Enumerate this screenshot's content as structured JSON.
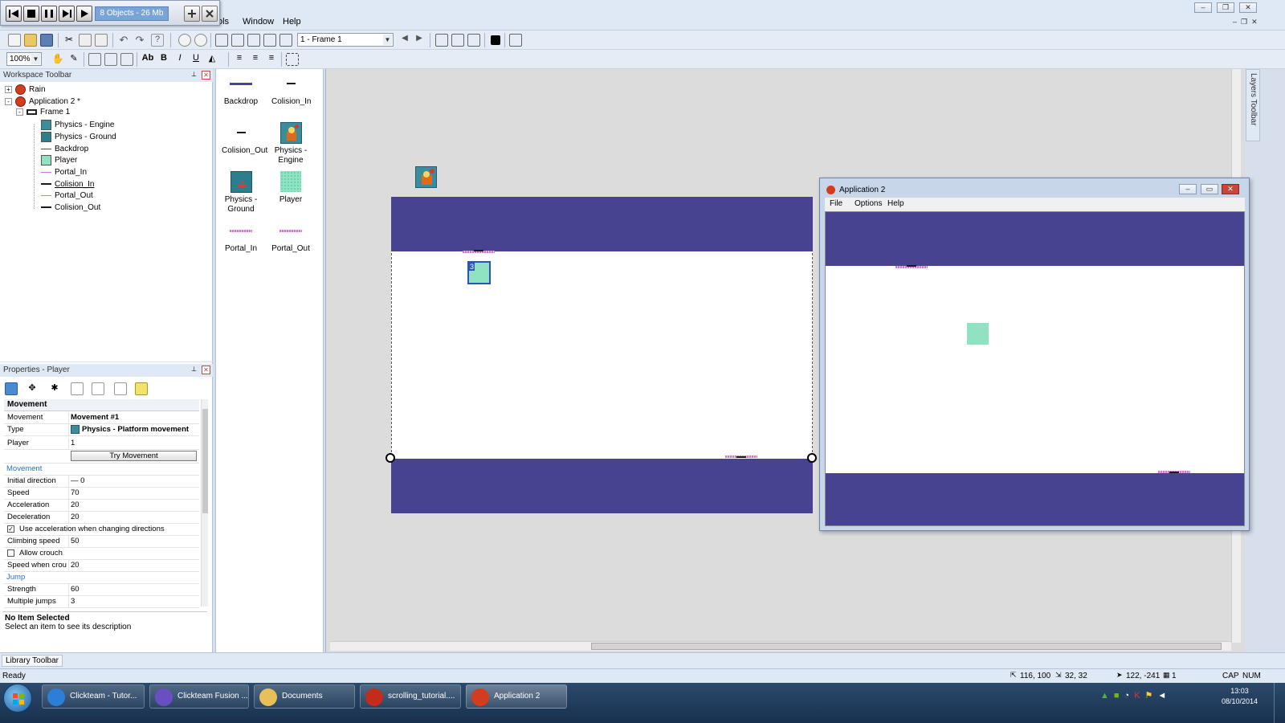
{
  "player_bar": {
    "object_count": "8 Objects - 26 Mb"
  },
  "menu": {
    "items": [
      "ols",
      "Window",
      "Help"
    ]
  },
  "toolbar": {
    "frame_combo": "1 - Frame 1",
    "zoom_combo": "100%"
  },
  "workspace": {
    "title": "Workspace Toolbar",
    "tree": [
      {
        "label": "Rain",
        "level": 0,
        "expander": "+"
      },
      {
        "label": "Application 2 *",
        "level": 0,
        "expander": "-"
      },
      {
        "label": "Frame 1",
        "level": 1,
        "expander": "-"
      },
      {
        "label": "Physics - Engine",
        "level": 2
      },
      {
        "label": "Physics - Ground",
        "level": 2
      },
      {
        "label": "Backdrop",
        "level": 2
      },
      {
        "label": "Player",
        "level": 2
      },
      {
        "label": "Portal_In",
        "level": 2
      },
      {
        "label": "Colision_In",
        "level": 2
      },
      {
        "label": "Portal_Out",
        "level": 2
      },
      {
        "label": "Colision_Out",
        "level": 2
      }
    ]
  },
  "object_list": [
    {
      "label": "Backdrop"
    },
    {
      "label": "Colision_In"
    },
    {
      "label": "Colision_Out"
    },
    {
      "label": "Physics - Engine"
    },
    {
      "label": "Physics - Ground"
    },
    {
      "label": "Player"
    },
    {
      "label": "Portal_In"
    },
    {
      "label": "Portal_Out"
    }
  ],
  "properties": {
    "title": "Properties - Player",
    "header": "Movement",
    "rows": [
      {
        "name": "Movement",
        "value": "Movement #1",
        "bold": true
      },
      {
        "name": "Type",
        "value": "Physics - Platform movement",
        "bold": true
      },
      {
        "name": "Player",
        "value": "1"
      },
      {
        "name": "",
        "value": "Try Movement",
        "button": true
      },
      {
        "name": "Movement",
        "value": "",
        "section": true
      },
      {
        "name": "Initial direction",
        "value": "— 0"
      },
      {
        "name": "Speed",
        "value": "70"
      },
      {
        "name": "Acceleration",
        "value": "20"
      },
      {
        "name": "Deceleration",
        "value": "20"
      },
      {
        "name": "Use acceleration when changing directions",
        "value": "",
        "checkbox": true,
        "checked": true
      },
      {
        "name": "Climbing speed",
        "value": "50"
      },
      {
        "name": "Allow crouch",
        "value": "",
        "checkbox": true,
        "checked": false
      },
      {
        "name": "Speed when crou",
        "value": "20"
      },
      {
        "name": "Jump",
        "value": "",
        "section": true
      },
      {
        "name": "Strength",
        "value": "60"
      },
      {
        "name": "Multiple jumps",
        "value": "3"
      }
    ],
    "desc_title": "No Item Selected",
    "desc_text": "Select an item to see its description"
  },
  "editor": {
    "player_tag": "3"
  },
  "app_window": {
    "title": "Application 2",
    "menu": [
      "File",
      "Options",
      "Help"
    ]
  },
  "library": {
    "tab": "Library Toolbar"
  },
  "status": {
    "text": "Ready",
    "coords": "116, 100",
    "size": "32, 32",
    "mouse": "122, -241",
    "layer": "1",
    "caps": "CAP",
    "num": "NUM"
  },
  "taskbar": {
    "items": [
      {
        "label": "Clickteam - Tutor...",
        "icon_color": "#2b7fd6"
      },
      {
        "label": "Clickteam Fusion ...",
        "icon_color": "#6a4fc2"
      },
      {
        "label": "Documents",
        "icon_color": "#e7c05a"
      },
      {
        "label": "scrolling_tutorial....",
        "icon_color": "#c42b1c"
      },
      {
        "label": "Application 2",
        "icon_color": "#d43c1e"
      }
    ],
    "time": "13:03",
    "date": "08/10/2014"
  },
  "colors": {
    "backdrop": "#484390",
    "player": "#8fe3c3",
    "portal": "#c77cc7"
  },
  "layers_toolbar": "Layers Toolbar"
}
